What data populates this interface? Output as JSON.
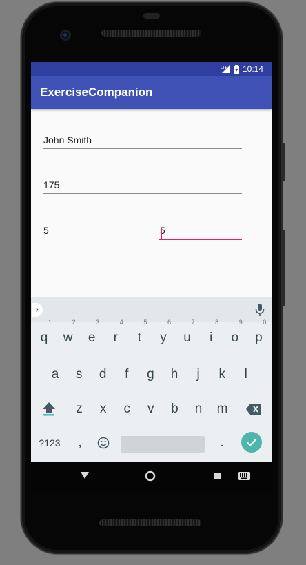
{
  "status_bar": {
    "network": "LTE",
    "time": "10:14"
  },
  "app": {
    "title": "ExerciseCompanion"
  },
  "form": {
    "name_value": "John Smith",
    "height_value": "175",
    "field3_value": "5",
    "field4_value": "5"
  },
  "keyboard": {
    "row1": [
      {
        "key": "q",
        "hint": "1"
      },
      {
        "key": "w",
        "hint": "2"
      },
      {
        "key": "e",
        "hint": "3"
      },
      {
        "key": "r",
        "hint": "4"
      },
      {
        "key": "t",
        "hint": "5"
      },
      {
        "key": "y",
        "hint": "6"
      },
      {
        "key": "u",
        "hint": "7"
      },
      {
        "key": "i",
        "hint": "8"
      },
      {
        "key": "o",
        "hint": "9"
      },
      {
        "key": "p",
        "hint": "0"
      }
    ],
    "row2": [
      "a",
      "s",
      "d",
      "f",
      "g",
      "h",
      "j",
      "k",
      "l"
    ],
    "row3": [
      "z",
      "x",
      "c",
      "v",
      "b",
      "n",
      "m"
    ],
    "symbols_label": "?123",
    "comma_label": ",",
    "period_label": ".",
    "accent_color": "#4db6ac"
  },
  "colors": {
    "status_bar": "#303f9f",
    "app_bar": "#3f51b5",
    "focus_underline": "#e91e63"
  },
  "icons": [
    "lte-signal-icon",
    "battery-charging-icon",
    "chevron-right-icon",
    "microphone-icon",
    "shift-icon",
    "backspace-icon",
    "emoji-icon",
    "check-icon",
    "back-icon",
    "home-icon",
    "recents-icon",
    "keyboard-switch-icon"
  ]
}
